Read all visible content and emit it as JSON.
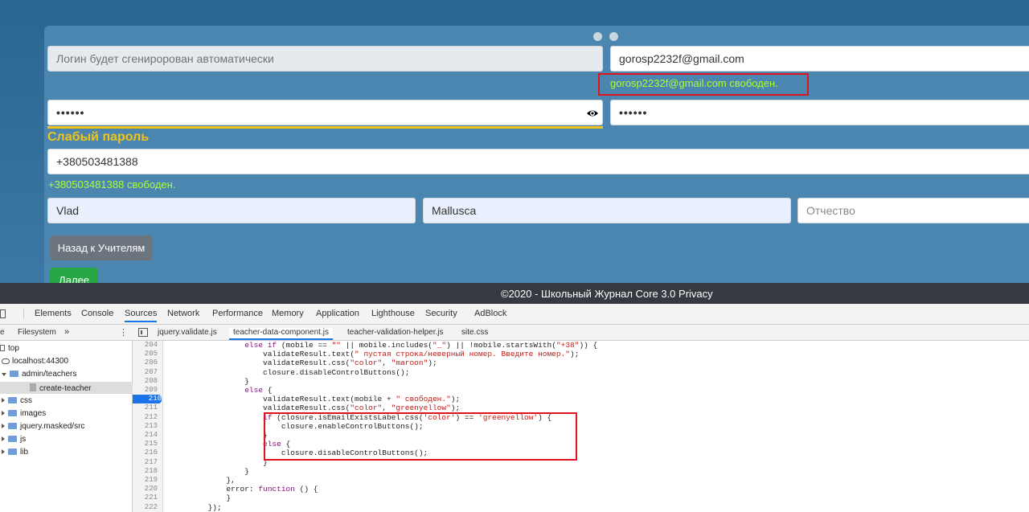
{
  "form": {
    "login_placeholder": "Логин будет сгениророван автоматически",
    "email_value": "gorosp2232f@gmail.com",
    "email_status": "gorosp2232f@gmail.com свободен.",
    "password_mask": "••••••",
    "confirm_mask": "••••••",
    "strength_label": "Слабый пароль",
    "phone_value": "+380503481388",
    "phone_status": "+380503481388 свободен.",
    "first_name": "Vlad",
    "last_name": "Mallusca",
    "patronymic_placeholder": "Отчество",
    "back_button": "Назад к Учителям",
    "next_button": "Далее"
  },
  "footer": {
    "text": "©2020 - Школьный Журнал Core 3.0 Privacy"
  },
  "devtools": {
    "tabs": [
      "Elements",
      "Console",
      "Sources",
      "Network",
      "Performance",
      "Memory",
      "Application",
      "Lighthouse",
      "Security",
      "AdBlock"
    ],
    "active_tab": "Sources",
    "left_tabs": [
      "e",
      "Filesystem",
      "»"
    ],
    "tree": [
      "top",
      "localhost:44300",
      "admin/teachers",
      "create-teacher",
      "css",
      "images",
      "jquery.masked/src",
      "js",
      "lib"
    ],
    "file_tabs": [
      "jquery.validate.js",
      "teacher-data-component.js",
      "teacher-validation-helper.js",
      "site.css"
    ],
    "active_file": "teacher-data-component.js",
    "code_lines": [
      {
        "n": "204",
        "t": "                else if (mobile == \"\" || mobile.includes(\"_\") || !mobile.startsWith(\"+38\")) {"
      },
      {
        "n": "205",
        "t": "                    validateResult.text(\" пустая строка/неверный номер. Введите номер.\");"
      },
      {
        "n": "206",
        "t": "                    validateResult.css(\"color\", \"maroon\");"
      },
      {
        "n": "207",
        "t": "                    closure.disableControlButtons();"
      },
      {
        "n": "208",
        "t": "                }"
      },
      {
        "n": "209",
        "t": "                else {"
      },
      {
        "n": "210",
        "t": "                    validateResult.text(mobile + \" свободен.\");"
      },
      {
        "n": "211",
        "t": "                    validateResult.css(\"color\", \"greenyellow\");"
      },
      {
        "n": "212",
        "t": "                    if (closure.isEmailExistsLabel.css('color') == 'greenyellow') {"
      },
      {
        "n": "213",
        "t": "                        closure.enableControlButtons();"
      },
      {
        "n": "214",
        "t": "                    }"
      },
      {
        "n": "215",
        "t": "                    else {"
      },
      {
        "n": "216",
        "t": "                        closure.disableControlButtons();"
      },
      {
        "n": "217",
        "t": "                    }"
      },
      {
        "n": "218",
        "t": "                }"
      },
      {
        "n": "219",
        "t": "            },"
      },
      {
        "n": "220",
        "t": "            error: function () {"
      },
      {
        "n": "221",
        "t": "            }"
      },
      {
        "n": "222",
        "t": "        });"
      }
    ]
  }
}
